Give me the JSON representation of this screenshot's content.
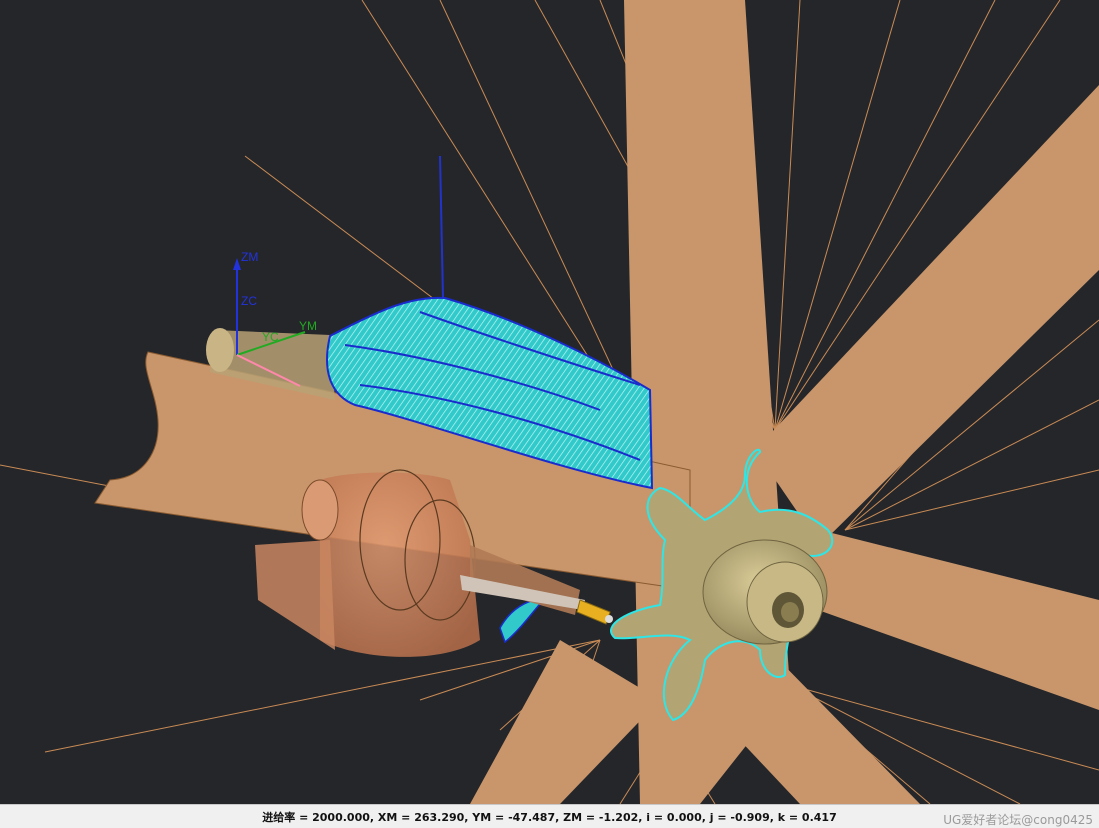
{
  "viewport": {
    "background": "#25262a",
    "part_color": "#c9966b",
    "toolpath_color": "#2ee6e6",
    "toolpath_edge_color": "#1a2ccc",
    "rotor_color": "#a89a6a"
  },
  "csys": {
    "zm": "ZM",
    "zc": "ZC",
    "ym": "YM",
    "yc": "YC",
    "z_color": "#2233dd",
    "y_color": "#22aa22"
  },
  "status": {
    "readout": "进给率 = 2000.000, XM = 263.290, YM = -47.487, ZM = -1.202, i = 0.000, j = -0.909, k = 0.417",
    "watermark": "UG爱好者论坛@cong0425"
  }
}
